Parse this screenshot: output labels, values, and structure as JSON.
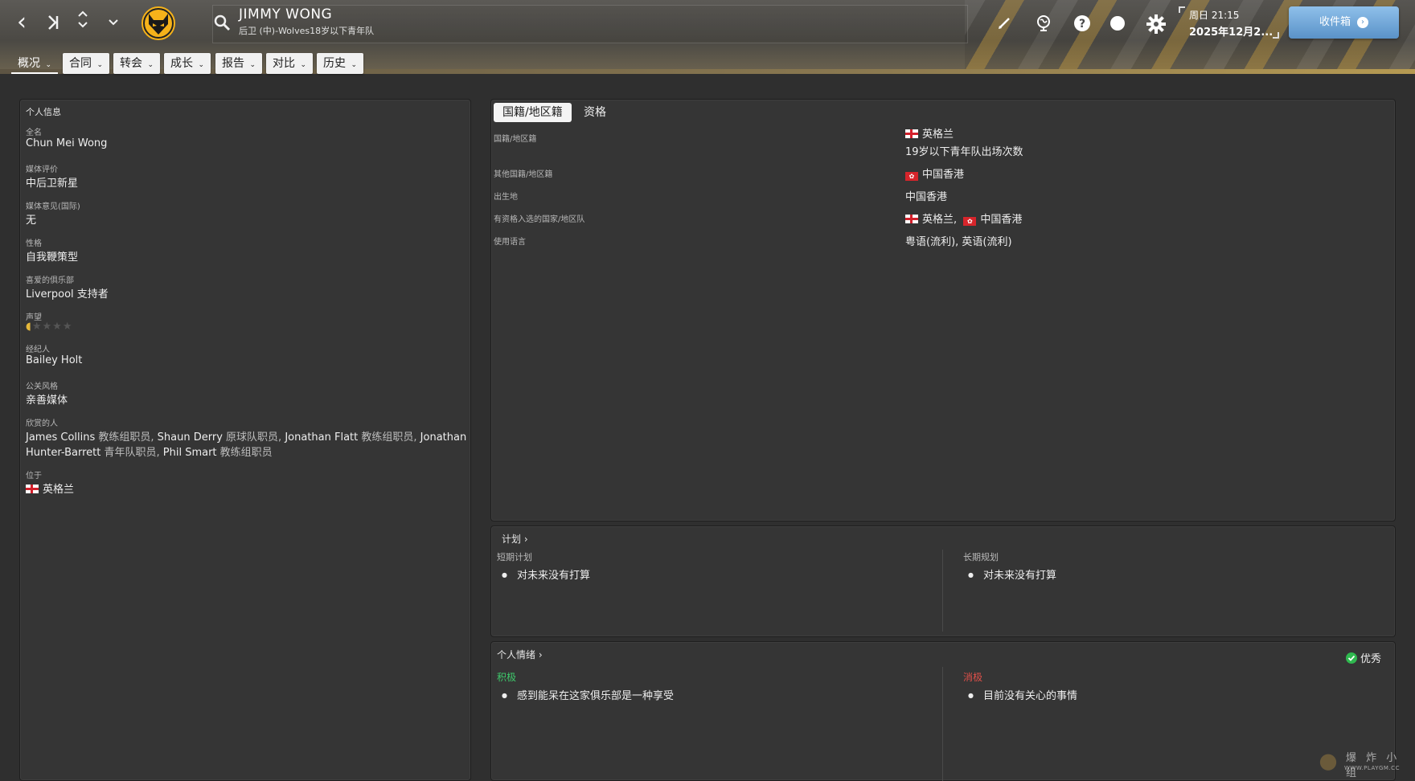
{
  "header": {
    "player_name": "JIMMY WONG",
    "player_subtitle": "后卫 (中)-Wolves18岁以下青年队",
    "date_day_time": "周日 21:15",
    "date_full": "2025年12月2...",
    "inbox_label": "收件箱",
    "nav_icons": [
      "back-arrow-icon",
      "skip-back-icon",
      "up-down-icon",
      "chevron-down-icon"
    ],
    "tool_icons": [
      "pencil-icon",
      "world-icon",
      "help-icon",
      "status-dot-icon",
      "gear-icon"
    ]
  },
  "tabs": [
    {
      "label": "概况",
      "active": true
    },
    {
      "label": "合同",
      "active": false
    },
    {
      "label": "转会",
      "active": false
    },
    {
      "label": "成长",
      "active": false
    },
    {
      "label": "报告",
      "active": false
    },
    {
      "label": "对比",
      "active": false
    },
    {
      "label": "历史",
      "active": false
    }
  ],
  "personal": {
    "section_title": "个人信息",
    "full_name_label": "全名",
    "full_name": "Chun Mei Wong",
    "media_rating_label": "媒体评价",
    "media_rating": "中后卫新星",
    "media_opinion_label": "媒体意见(国际)",
    "media_opinion": "无",
    "personality_label": "性格",
    "personality": "自我鞭策型",
    "fav_club_label": "喜爱的俱乐部",
    "fav_club": "Liverpool 支持者",
    "reputation_label": "声望",
    "reputation_stars": 0.5,
    "agent_label": "经纪人",
    "agent": "Bailey Holt",
    "pr_label": "公关风格",
    "pr": "亲善媒体",
    "admired_label": "欣赏的人",
    "admired_line1_a": "James Collins",
    "admired_line1_b": "教练组职员,",
    "admired_line1_c": "Shaun Derry",
    "admired_line1_d": "原球队职员,",
    "admired_line1_e": "Jonathan Flatt",
    "admired_line1_f": "教练组职员,",
    "admired_line1_g": "Jonathan",
    "admired_line2_a": "Hunter-Barrett",
    "admired_line2_b": "青年队职员,",
    "admired_line2_c": "Phil Smart",
    "admired_line2_d": "教练组职员",
    "location_label": "位于",
    "location": "英格兰"
  },
  "nationality": {
    "tab_nationality": "国籍/地区籍",
    "tab_eligibility": "资格",
    "rows": [
      {
        "label": "国籍/地区籍",
        "value": "英格兰",
        "value2": "19岁以下青年队出场次数"
      },
      {
        "label": "其他国籍/地区籍",
        "value": "中国香港"
      },
      {
        "label": "出生地",
        "value": "中国香港"
      },
      {
        "label": "有资格入选的国家/地区队",
        "value": "英格兰,",
        "value_b": "中国香港"
      },
      {
        "label": "使用语言",
        "value": "粤语(流利), 英语(流利)"
      }
    ]
  },
  "plans": {
    "title": "计划",
    "short_label": "短期计划",
    "short_item": "对未来没有打算",
    "long_label": "长期规划",
    "long_item": "对未来没有打算"
  },
  "mood": {
    "title": "个人情绪",
    "status": "优秀",
    "positive_label": "积极",
    "positive_item": "感到能呆在这家俱乐部是一种享受",
    "negative_label": "消极",
    "negative_item": "目前没有关心的事情",
    "positive_color": "#3ec96b",
    "negative_color": "#e0504a",
    "status_color": "#2fb84f"
  },
  "watermark": {
    "cn": "爆 炸 小 组",
    "url": "WWW.PLAYGM.CC"
  }
}
